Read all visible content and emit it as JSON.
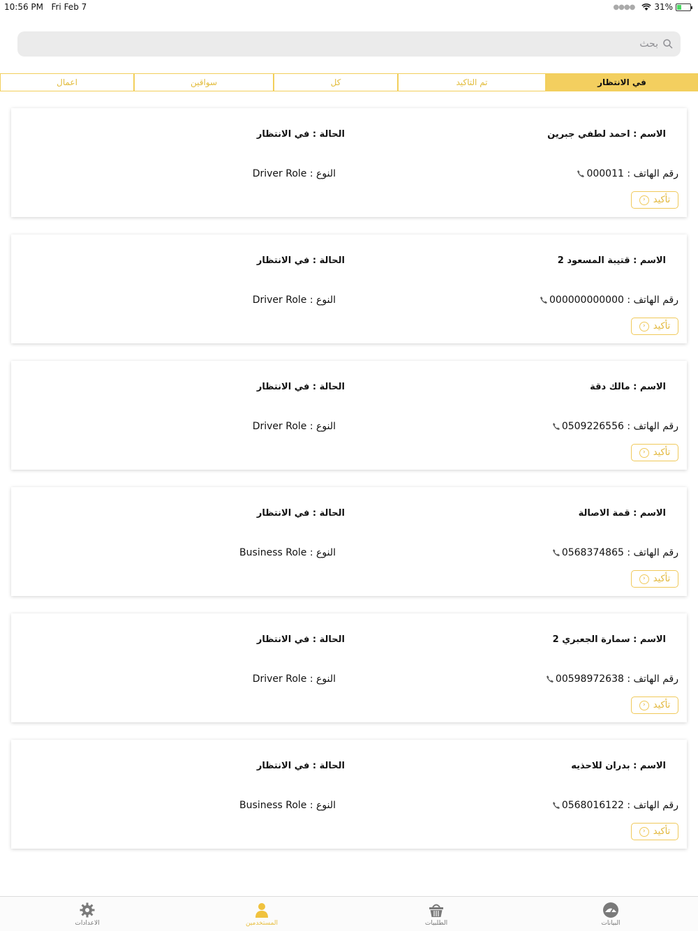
{
  "status_bar": {
    "time": "10:56 PM",
    "date": "Fri Feb 7",
    "battery": "31%"
  },
  "search": {
    "placeholder": "بحث"
  },
  "tabs": [
    {
      "label": "في الانتظار",
      "active": true
    },
    {
      "label": "تم التاكيد",
      "active": false
    },
    {
      "label": "كل",
      "active": false
    },
    {
      "label": "سواقين",
      "active": false
    },
    {
      "label": "اعمال",
      "active": false
    }
  ],
  "users": [
    {
      "name": "الاسم : احمد لطفي جبرين",
      "status": "الحالة : في الانتظار",
      "phone": "رقم الهاتف : 000011",
      "role": "النوع : Driver Role",
      "confirm": "تأكيد"
    },
    {
      "name": "الاسم : قتيبة المسعود 2",
      "status": "الحالة : في الانتظار",
      "phone": "رقم الهاتف : 000000000000",
      "role": "النوع : Driver Role",
      "confirm": "تأكيد"
    },
    {
      "name": "الاسم : مالك دقة",
      "status": "الحالة : في الانتظار",
      "phone": "رقم الهاتف : 0509226556",
      "role": "النوع : Driver Role",
      "confirm": "تأكيد"
    },
    {
      "name": "الاسم : قمة الاصالة",
      "status": "الحالة : في الانتظار",
      "phone": "رقم الهاتف : 0568374865",
      "role": "النوع : Business Role",
      "confirm": "تأكيد"
    },
    {
      "name": "الاسم : سمارة الجعبري 2",
      "status": "الحالة : في الانتظار",
      "phone": "رقم الهاتف : 00598972638",
      "role": "النوع : Driver Role",
      "confirm": "تأكيد"
    },
    {
      "name": "الاسم : بدران للاحذيه",
      "status": "الحالة : في الانتظار",
      "phone": "رقم الهاتف : 0568016122",
      "role": "النوع : Business Role",
      "confirm": "تأكيد"
    }
  ],
  "tabbar": [
    {
      "label": "الاعدادات",
      "icon": "gear-icon",
      "active": false
    },
    {
      "label": "المستخدمين",
      "icon": "user-icon",
      "active": true
    },
    {
      "label": "الطلبيات",
      "icon": "basket-icon",
      "active": false
    },
    {
      "label": "البيانات",
      "icon": "gauge-icon",
      "active": false
    }
  ],
  "colors": {
    "accent": "#f3cf5f",
    "accent_text": "#e2bc3c"
  }
}
